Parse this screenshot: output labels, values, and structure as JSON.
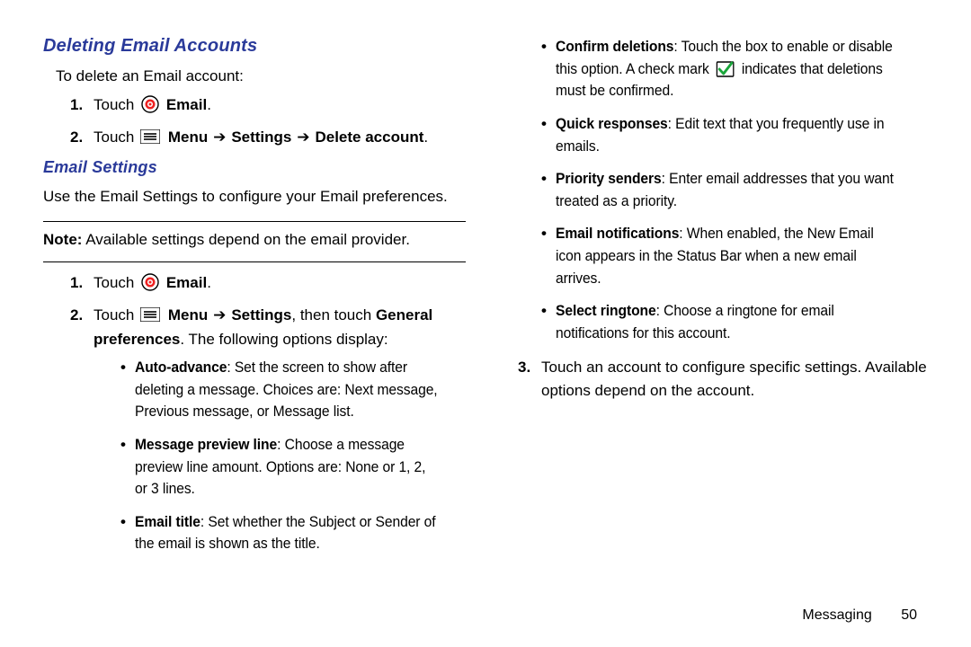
{
  "left": {
    "h1": "Deleting Email Accounts",
    "intro": "To delete an Email account:",
    "step1_pre": "Touch ",
    "step1_post": "Email",
    "step1_dot": ".",
    "step2_pre": "Touch ",
    "step2_menu": "Menu",
    "step2_arrow": " ➔ ",
    "step2_settings": "Settings",
    "step2_delete": "Delete account",
    "h2": "Email Settings",
    "p2": "Use the Email Settings to configure your Email preferences.",
    "noteLabel": "Note:",
    "noteText": " Available settings depend on the email provider.",
    "s2_step1_pre": "Touch ",
    "s2_step1_email": "Email",
    "s2_step2_pre": "Touch ",
    "s2_step2_menu": "Menu",
    "s2_step2_arrow": " ➔ ",
    "s2_step2_settings": "Settings",
    "s2_step2_mid": ", then touch ",
    "s2_step2_general": "General preferences",
    "s2_step2_tail": ". The following options display:",
    "b1_t": "Auto-advance",
    "b1_d": ": Set the screen to show after deleting a message. Choices are: Next message, Previous message, or Message list.",
    "b2_t": "Message preview line",
    "b2_d": ": Choose a message preview line amount. Options are: None or 1, 2, or 3 lines.",
    "b3_t": "Email title",
    "b3_d": ": Set whether the Subject or Sender of the email is shown as the title."
  },
  "right": {
    "b4_t": "Confirm deletions",
    "b4_d1": ": Touch the box to enable or disable this option. A check mark ",
    "b4_d2": " indicates that deletions must be confirmed.",
    "b5_t": "Quick responses",
    "b5_d": ": Edit text that you frequently use in emails.",
    "b6_t": "Priority senders",
    "b6_d": ": Enter email addresses that you want treated as a priority.",
    "b7_t": "Email notifications",
    "b7_d": ": When enabled, the New Email icon appears in the Status Bar when a new email arrives.",
    "b8_t": "Select ringtone",
    "b8_d": ": Choose a ringtone for email notifications for this account.",
    "step3": "Touch an account to configure specific settings. Available options depend on the account."
  },
  "footer": {
    "section": "Messaging",
    "page": "50"
  }
}
